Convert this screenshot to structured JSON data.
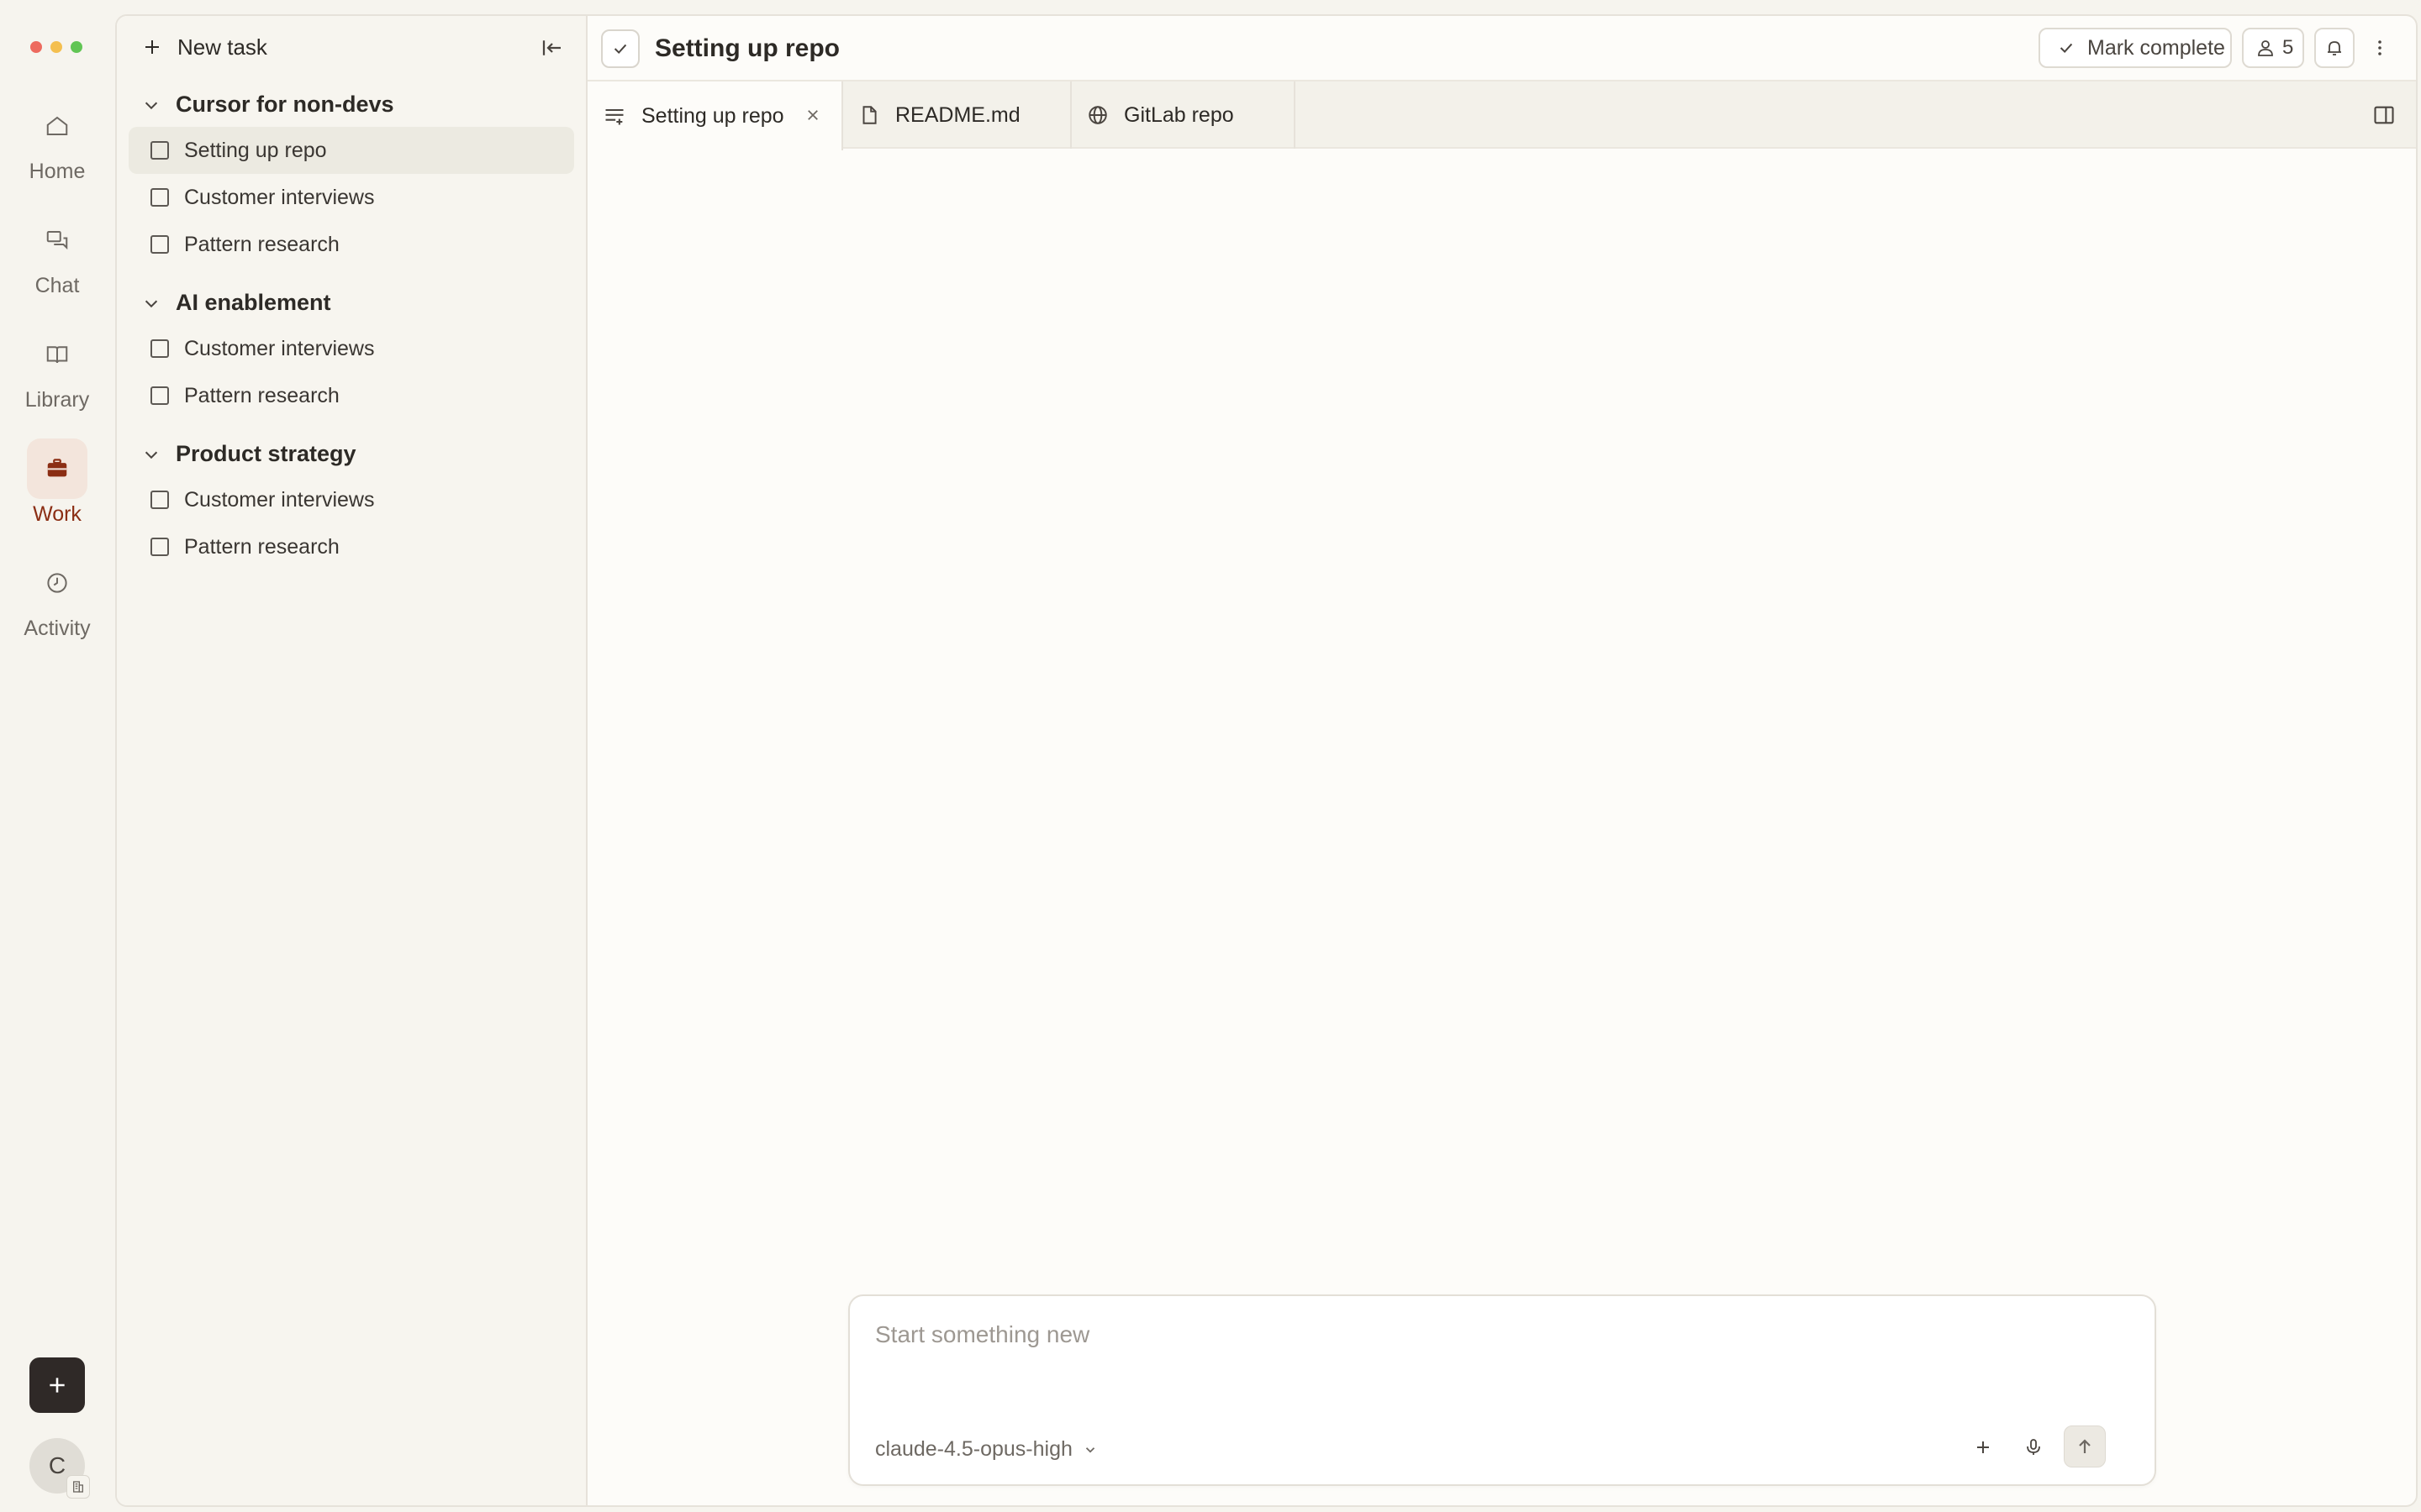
{
  "window": {
    "controls": [
      "close",
      "minimize",
      "zoom"
    ]
  },
  "rail": {
    "items": [
      {
        "id": "home",
        "label": "Home",
        "icon": "home-icon"
      },
      {
        "id": "chat",
        "label": "Chat",
        "icon": "chat-icon"
      },
      {
        "id": "library",
        "label": "Library",
        "icon": "book-icon"
      },
      {
        "id": "work",
        "label": "Work",
        "icon": "briefcase-icon",
        "active": true
      },
      {
        "id": "activity",
        "label": "Activity",
        "icon": "clock-icon"
      }
    ],
    "avatar_initial": "C"
  },
  "sidebar": {
    "new_task_label": "New task",
    "groups": [
      {
        "name": "Cursor for non-devs",
        "tasks": [
          "Setting up repo",
          "Customer interviews",
          "Pattern research"
        ]
      },
      {
        "name": "AI enablement",
        "tasks": [
          "Customer interviews",
          "Pattern research"
        ]
      },
      {
        "name": "Product strategy",
        "tasks": [
          "Customer interviews",
          "Pattern research"
        ]
      }
    ]
  },
  "header": {
    "title": "Setting up repo",
    "mark_complete_label": "Mark complete",
    "member_count": "5"
  },
  "tabs": [
    {
      "label": "Setting up repo",
      "icon": "text-lines-icon",
      "active": true
    },
    {
      "label": "README.md",
      "icon": "file-icon"
    },
    {
      "label": "GitLab repo",
      "icon": "globe-icon"
    }
  ],
  "composer": {
    "placeholder": "Start something new",
    "model": "claude-4.5-opus-high"
  },
  "colors": {
    "accent": "#8b2e14",
    "accent_bg": "#f3e5dc",
    "traffic_red": "#ed6a5e",
    "traffic_yellow": "#f4bf4f",
    "traffic_green": "#61c554"
  }
}
